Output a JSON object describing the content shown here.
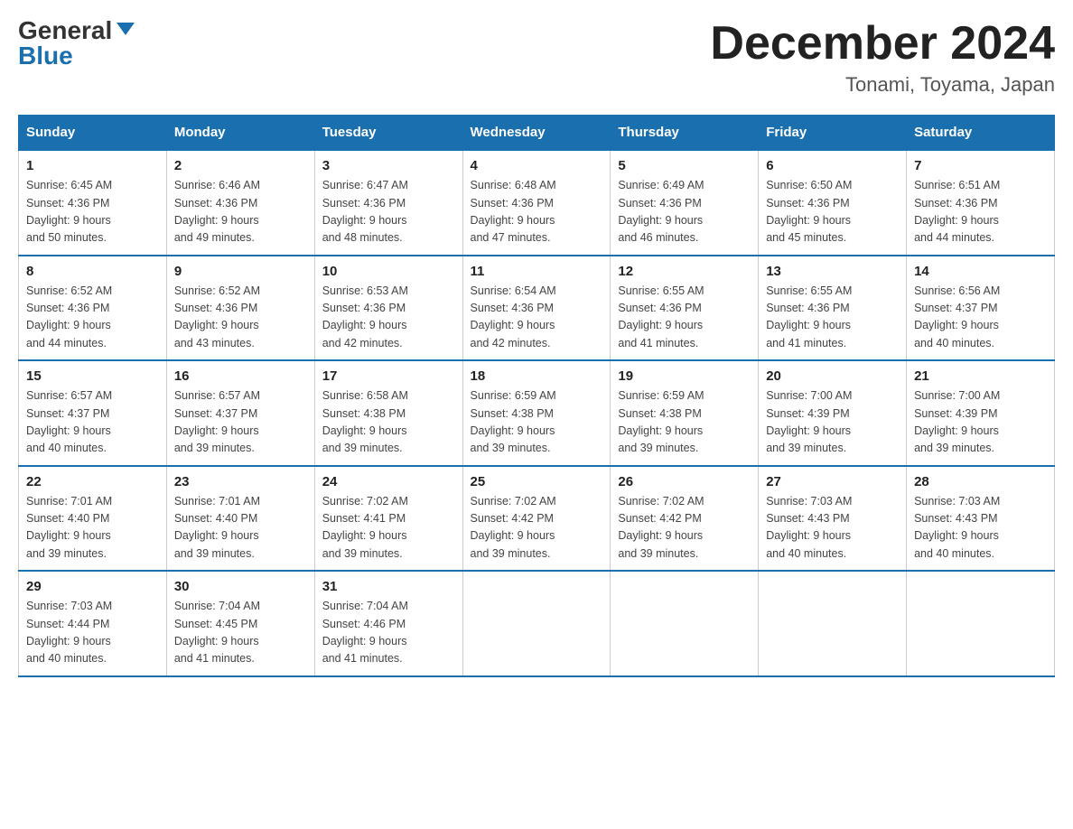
{
  "header": {
    "logo_general": "General",
    "logo_blue": "Blue",
    "month_title": "December 2024",
    "location": "Tonami, Toyama, Japan"
  },
  "weekdays": [
    "Sunday",
    "Monday",
    "Tuesday",
    "Wednesday",
    "Thursday",
    "Friday",
    "Saturday"
  ],
  "weeks": [
    [
      {
        "day": "1",
        "sunrise": "6:45 AM",
        "sunset": "4:36 PM",
        "daylight": "9 hours and 50 minutes."
      },
      {
        "day": "2",
        "sunrise": "6:46 AM",
        "sunset": "4:36 PM",
        "daylight": "9 hours and 49 minutes."
      },
      {
        "day": "3",
        "sunrise": "6:47 AM",
        "sunset": "4:36 PM",
        "daylight": "9 hours and 48 minutes."
      },
      {
        "day": "4",
        "sunrise": "6:48 AM",
        "sunset": "4:36 PM",
        "daylight": "9 hours and 47 minutes."
      },
      {
        "day": "5",
        "sunrise": "6:49 AM",
        "sunset": "4:36 PM",
        "daylight": "9 hours and 46 minutes."
      },
      {
        "day": "6",
        "sunrise": "6:50 AM",
        "sunset": "4:36 PM",
        "daylight": "9 hours and 45 minutes."
      },
      {
        "day": "7",
        "sunrise": "6:51 AM",
        "sunset": "4:36 PM",
        "daylight": "9 hours and 44 minutes."
      }
    ],
    [
      {
        "day": "8",
        "sunrise": "6:52 AM",
        "sunset": "4:36 PM",
        "daylight": "9 hours and 44 minutes."
      },
      {
        "day": "9",
        "sunrise": "6:52 AM",
        "sunset": "4:36 PM",
        "daylight": "9 hours and 43 minutes."
      },
      {
        "day": "10",
        "sunrise": "6:53 AM",
        "sunset": "4:36 PM",
        "daylight": "9 hours and 42 minutes."
      },
      {
        "day": "11",
        "sunrise": "6:54 AM",
        "sunset": "4:36 PM",
        "daylight": "9 hours and 42 minutes."
      },
      {
        "day": "12",
        "sunrise": "6:55 AM",
        "sunset": "4:36 PM",
        "daylight": "9 hours and 41 minutes."
      },
      {
        "day": "13",
        "sunrise": "6:55 AM",
        "sunset": "4:36 PM",
        "daylight": "9 hours and 41 minutes."
      },
      {
        "day": "14",
        "sunrise": "6:56 AM",
        "sunset": "4:37 PM",
        "daylight": "9 hours and 40 minutes."
      }
    ],
    [
      {
        "day": "15",
        "sunrise": "6:57 AM",
        "sunset": "4:37 PM",
        "daylight": "9 hours and 40 minutes."
      },
      {
        "day": "16",
        "sunrise": "6:57 AM",
        "sunset": "4:37 PM",
        "daylight": "9 hours and 39 minutes."
      },
      {
        "day": "17",
        "sunrise": "6:58 AM",
        "sunset": "4:38 PM",
        "daylight": "9 hours and 39 minutes."
      },
      {
        "day": "18",
        "sunrise": "6:59 AM",
        "sunset": "4:38 PM",
        "daylight": "9 hours and 39 minutes."
      },
      {
        "day": "19",
        "sunrise": "6:59 AM",
        "sunset": "4:38 PM",
        "daylight": "9 hours and 39 minutes."
      },
      {
        "day": "20",
        "sunrise": "7:00 AM",
        "sunset": "4:39 PM",
        "daylight": "9 hours and 39 minutes."
      },
      {
        "day": "21",
        "sunrise": "7:00 AM",
        "sunset": "4:39 PM",
        "daylight": "9 hours and 39 minutes."
      }
    ],
    [
      {
        "day": "22",
        "sunrise": "7:01 AM",
        "sunset": "4:40 PM",
        "daylight": "9 hours and 39 minutes."
      },
      {
        "day": "23",
        "sunrise": "7:01 AM",
        "sunset": "4:40 PM",
        "daylight": "9 hours and 39 minutes."
      },
      {
        "day": "24",
        "sunrise": "7:02 AM",
        "sunset": "4:41 PM",
        "daylight": "9 hours and 39 minutes."
      },
      {
        "day": "25",
        "sunrise": "7:02 AM",
        "sunset": "4:42 PM",
        "daylight": "9 hours and 39 minutes."
      },
      {
        "day": "26",
        "sunrise": "7:02 AM",
        "sunset": "4:42 PM",
        "daylight": "9 hours and 39 minutes."
      },
      {
        "day": "27",
        "sunrise": "7:03 AM",
        "sunset": "4:43 PM",
        "daylight": "9 hours and 40 minutes."
      },
      {
        "day": "28",
        "sunrise": "7:03 AM",
        "sunset": "4:43 PM",
        "daylight": "9 hours and 40 minutes."
      }
    ],
    [
      {
        "day": "29",
        "sunrise": "7:03 AM",
        "sunset": "4:44 PM",
        "daylight": "9 hours and 40 minutes."
      },
      {
        "day": "30",
        "sunrise": "7:04 AM",
        "sunset": "4:45 PM",
        "daylight": "9 hours and 41 minutes."
      },
      {
        "day": "31",
        "sunrise": "7:04 AM",
        "sunset": "4:46 PM",
        "daylight": "9 hours and 41 minutes."
      },
      null,
      null,
      null,
      null
    ]
  ]
}
